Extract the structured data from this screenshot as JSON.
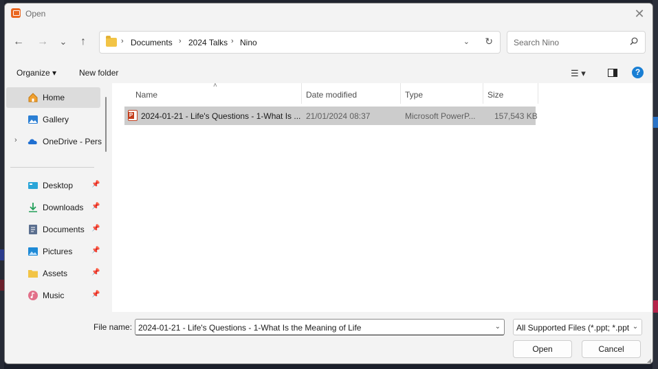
{
  "window": {
    "title": "Open",
    "close_glyph": "✕"
  },
  "nav": {
    "back_glyph": "←",
    "forward_glyph": "→",
    "recent_glyph": "⌄",
    "up_glyph": "↑",
    "breadcrumbs": [
      "Documents",
      "2024 Talks",
      "Nino"
    ],
    "separator": "›",
    "dropdown_glyph": "⌄",
    "refresh_glyph": "↻"
  },
  "search": {
    "placeholder": "Search Nino"
  },
  "commands": {
    "organize": "Organize ▾",
    "new_folder": "New folder",
    "view_glyph": "☰ ▾",
    "help_glyph": "?"
  },
  "sidebar": {
    "items": [
      {
        "label": "Home",
        "icon": "home-icon",
        "pinned": false
      },
      {
        "label": "Gallery",
        "icon": "gallery-icon",
        "pinned": false
      },
      {
        "label": "OneDrive - Personal",
        "icon": "cloud-icon",
        "pinned": false
      },
      {
        "label": "Desktop",
        "icon": "desktop-icon",
        "pinned": true
      },
      {
        "label": "Downloads",
        "icon": "download-icon",
        "pinned": true
      },
      {
        "label": "Documents",
        "icon": "document-icon",
        "pinned": true
      },
      {
        "label": "Pictures",
        "icon": "picture-icon",
        "pinned": true
      },
      {
        "label": "Assets",
        "icon": "folder-icon",
        "pinned": true
      },
      {
        "label": "Music",
        "icon": "music-icon",
        "pinned": true
      }
    ],
    "expander_glyph": "›",
    "pin_glyph": "📌"
  },
  "columns": {
    "name": "Name",
    "date": "Date modified",
    "type": "Type",
    "size": "Size",
    "sort_glyph": "˄"
  },
  "files": [
    {
      "name": "2024-01-21 - Life's Questions - 1-What Is ...",
      "date": "21/01/2024 08:37",
      "type": "Microsoft PowerP...",
      "size": "157,543 KB"
    }
  ],
  "footer": {
    "filename_label": "File name:",
    "filename_value": "2024-01-21 - Life's Questions - 1-What Is the Meaning of Life",
    "filetype_value": "All Supported Files (*.ppt; *.ppt",
    "dropdown_glyph": "⌄",
    "open_label": "Open",
    "cancel_label": "Cancel"
  },
  "colors": {
    "accent": "#1a7fd4",
    "selection": "#cccccc",
    "ppt": "#c43e1c",
    "folder": "#f2c446"
  }
}
